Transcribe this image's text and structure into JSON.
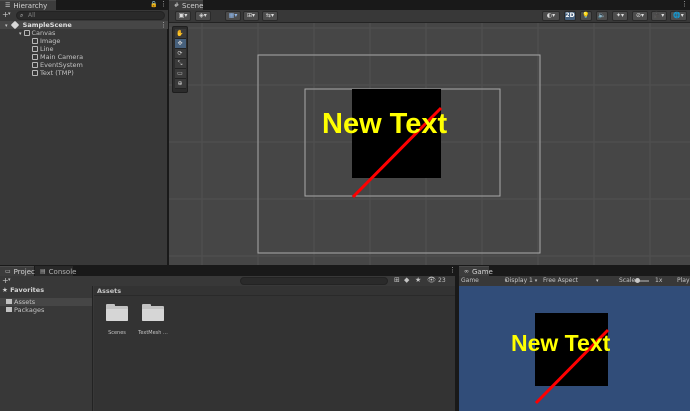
{
  "hierarchy": {
    "tab_label": "Hierarchy",
    "search_placeholder": "All",
    "scene_name": "SampleScene",
    "items": [
      {
        "label": "Canvas"
      },
      {
        "label": "Image"
      },
      {
        "label": "Line"
      },
      {
        "label": "Main Camera"
      },
      {
        "label": "EventSystem"
      },
      {
        "label": "Text (TMP)"
      }
    ]
  },
  "scene": {
    "tab_label": "Scene",
    "toolbar": {
      "mode_2d": "2D"
    },
    "canvas_text": "New Text",
    "colors": {
      "background": "#464646",
      "image": "#000000",
      "line": "#ff0000",
      "text": "#ffff00"
    }
  },
  "project": {
    "tab_project": "Project",
    "tab_console": "Console",
    "favorites_label": "Favorites",
    "tree": [
      {
        "label": "Assets"
      },
      {
        "label": "Packages"
      }
    ],
    "breadcrumb": "Assets",
    "hidden_count": "23",
    "folders": [
      {
        "label": "Scenes"
      },
      {
        "label": "TextMesh ..."
      }
    ]
  },
  "game": {
    "tab_label": "Game",
    "mode": "Game",
    "display": "Display 1",
    "aspect": "Free Aspect",
    "scale_label": "Scale",
    "scale_value": "1x",
    "play_label": "Play",
    "canvas_text": "New Text",
    "colors": {
      "background": "#314d79"
    }
  }
}
